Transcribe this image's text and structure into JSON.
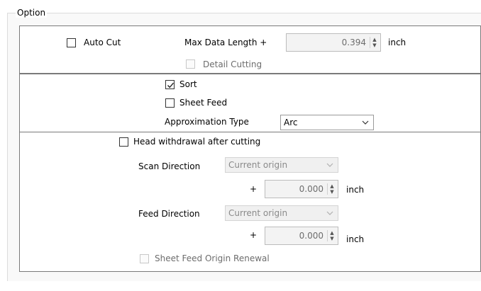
{
  "option_group": {
    "title": "Option",
    "auto_cut": {
      "label": "Auto Cut",
      "checked": false
    },
    "max_data_length": {
      "label": "Max Data Length +",
      "value": "0.394",
      "unit": "inch"
    },
    "detail_cutting": {
      "label": "Detail Cutting",
      "checked": false,
      "enabled": false
    },
    "sort": {
      "label": "Sort",
      "checked": true
    },
    "sheet_feed": {
      "label": "Sheet Feed",
      "checked": false
    },
    "approximation_type": {
      "label": "Approximation Type",
      "value": "Arc"
    },
    "head_withdrawal": {
      "label": "Head withdrawal after cutting",
      "checked": false
    },
    "scan_direction": {
      "label": "Scan Direction",
      "value": "Current origin",
      "offset_prefix": "+",
      "offset_value": "0.000",
      "unit": "inch"
    },
    "feed_direction": {
      "label": "Feed Direction",
      "value": "Current origin",
      "offset_prefix": "+",
      "offset_value": "0.000",
      "unit": "inch"
    },
    "sheet_feed_origin_renewal": {
      "label": "Sheet Feed Origin Renewal",
      "checked": false,
      "enabled": false
    }
  },
  "icons": {
    "spin_up": "triangle-up",
    "spin_down": "triangle-down",
    "combo_arrow": "chevron-down",
    "check": "check-mark"
  },
  "colors": {
    "border_section": "#7a7a7a",
    "disabled_text": "#6d6d6d",
    "disabled_field": "#f3f3f3"
  }
}
